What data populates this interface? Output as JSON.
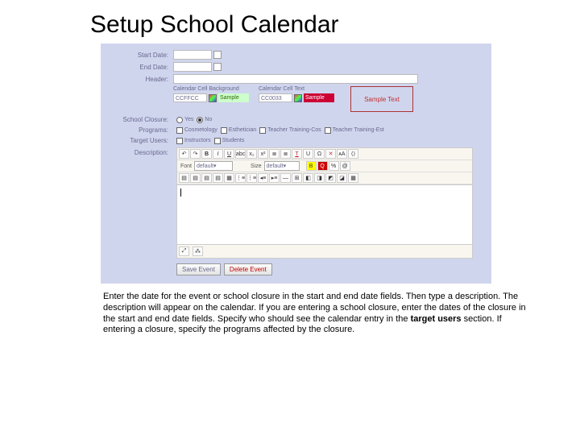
{
  "title": "Setup School Calendar",
  "labels": {
    "start_date": "Start Date:",
    "end_date": "End Date:",
    "header": "Header:",
    "school_closure": "School Closure:",
    "programs": "Programs:",
    "target_users": "Target Users:",
    "description": "Description:"
  },
  "color_section": {
    "bg_label": "Calendar Cell Background",
    "bg_value": "CCFFCC",
    "bg_sample": "Sample",
    "text_label": "Calendar Cell Text",
    "text_value": "CC0033",
    "text_sample": "Sample",
    "preview": "Sample Text"
  },
  "closure": {
    "yes": "Yes",
    "no": "No",
    "selected": "no"
  },
  "programs": [
    "Cosmetology",
    "Esthetician",
    "Teacher Training-Cos",
    "Teacher Training-Est"
  ],
  "target_users": [
    "Instructors",
    "Students"
  ],
  "editor": {
    "font_label": "Font",
    "font_value": "default",
    "size_label": "Size",
    "size_value": "default",
    "icons_row1": [
      "↶",
      "↷",
      "B",
      "I",
      "U",
      "abc",
      "x₂",
      "x²",
      "≣",
      "≣",
      "T",
      "U",
      "Ω",
      "✕",
      "ᴀA",
      "⟨⟩"
    ],
    "icons_row2a": [
      "B",
      "Q",
      "%",
      "@"
    ],
    "icons_row3": [
      "▤",
      "▤",
      "▤",
      "▤",
      "▦",
      "⋮≡",
      "⋮≡",
      "◂≡",
      "▸≡",
      "—",
      "⊞",
      "◧",
      "◨",
      "◩",
      "◪",
      "▦"
    ]
  },
  "actions": {
    "save": "Save Event",
    "delete": "Delete Event"
  },
  "footer_icons": [
    "⤢",
    "⁂"
  ],
  "instructions": {
    "p1a": "Enter the date for the event or school closure in the start and end date fields. Then type a description. The description will appear on the calendar.  If you are entering a school closure, enter the dates of the closure in the start and end date fields. Specify who should see the calendar entry in the ",
    "bold": "target users",
    "p1b": " section. If entering a closure, specify the programs affected by the closure."
  }
}
